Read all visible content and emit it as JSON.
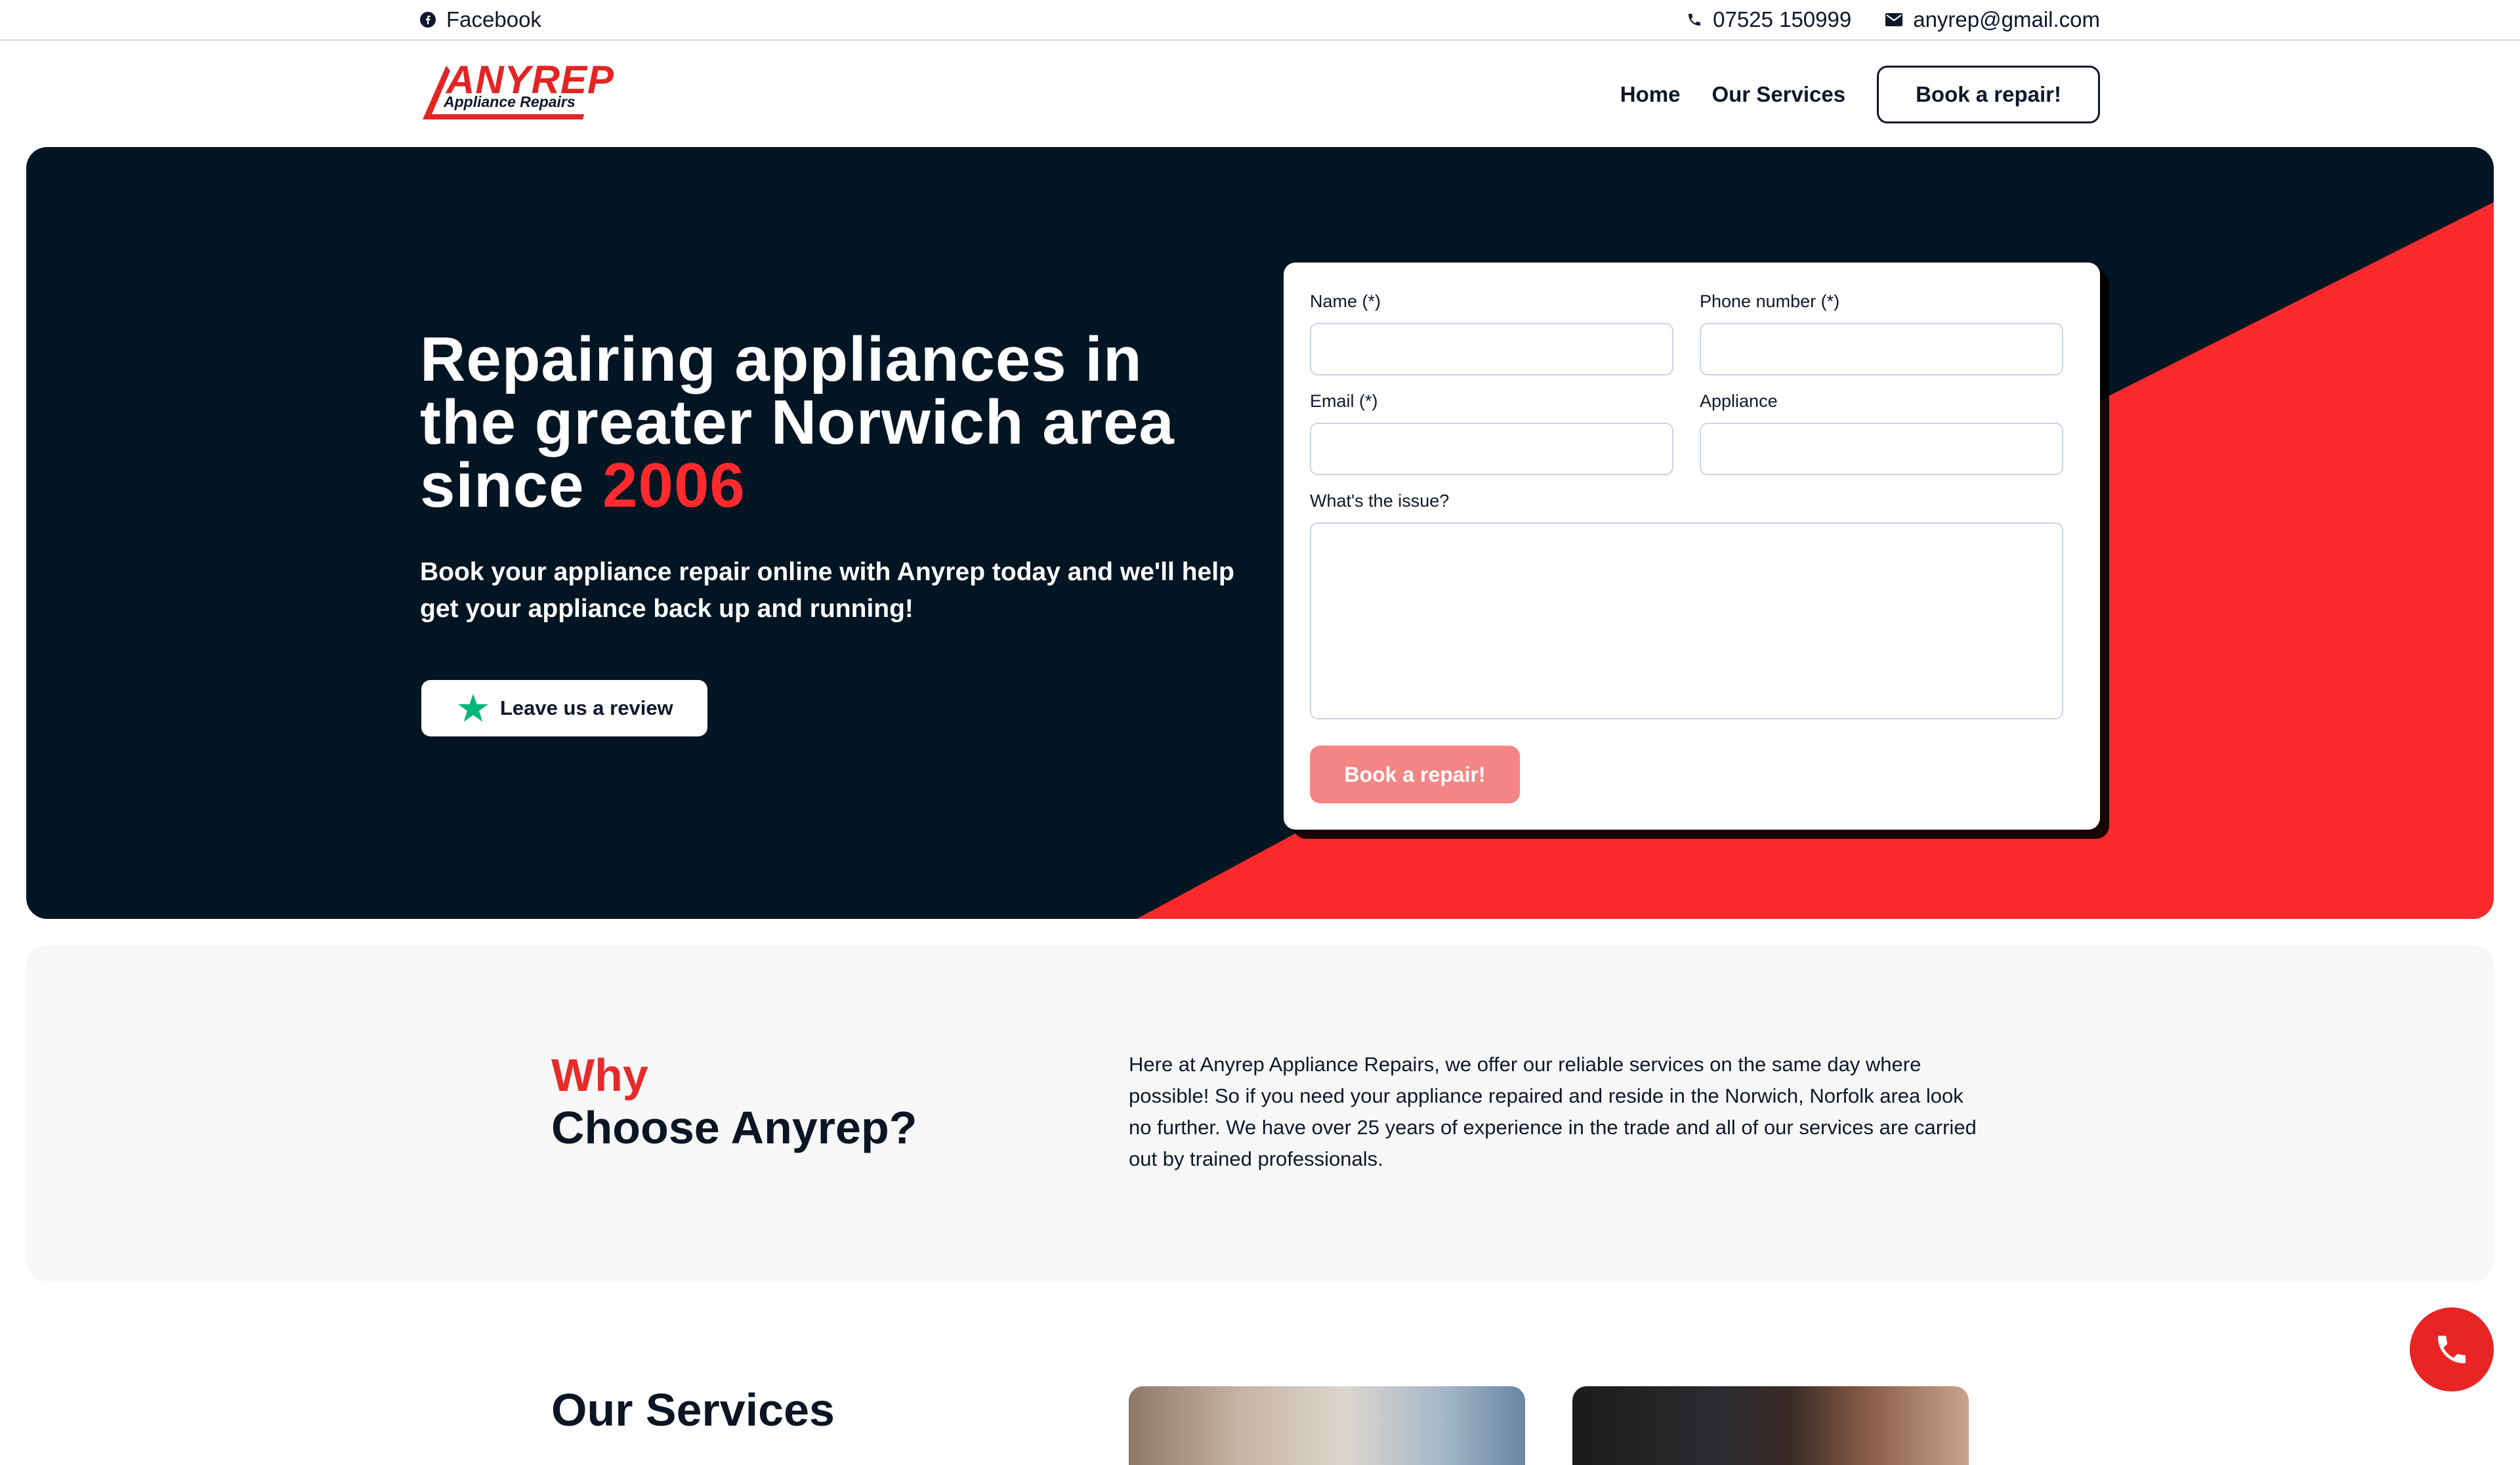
{
  "topbar": {
    "facebook": "Facebook",
    "phone": "07525 150999",
    "email": "anyrep@gmail.com"
  },
  "logo": {
    "word": "ANYREP",
    "sub": "Appliance Repairs"
  },
  "nav": {
    "home": "Home",
    "services": "Our Services",
    "book": "Book a repair!"
  },
  "hero": {
    "title_main": "Repairing appliances in the greater Norwich area since ",
    "title_year": "2006",
    "subtitle": "Book your appliance repair online with Anyrep today and we'll help get your appliance back up and running!",
    "review_label": "Leave us a review"
  },
  "form": {
    "name_label": "Name (*)",
    "phone_label": "Phone number (*)",
    "email_label": "Email (*)",
    "appliance_label": "Appliance",
    "issue_label": "What's the issue?",
    "submit_label": "Book a repair!"
  },
  "why": {
    "title_red": "Why",
    "title_dark": "Choose Anyrep?",
    "text": "Here at Anyrep Appliance Repairs, we offer our reliable services on the same day where possible! So if you need your appliance repaired and reside in the Norwich, Norfolk area look no further. We have over 25 years of experience in the trade and all of our services are carried out by trained professionals."
  },
  "services": {
    "title": "Our Services"
  },
  "colors": {
    "brand_red": "#e82424",
    "hero_bg": "#021523",
    "star_green": "#00b67a"
  },
  "icons": {
    "facebook": "facebook-icon",
    "phone": "phone-icon",
    "email": "envelope-icon",
    "review": "star-icon",
    "fab": "phone-icon"
  }
}
